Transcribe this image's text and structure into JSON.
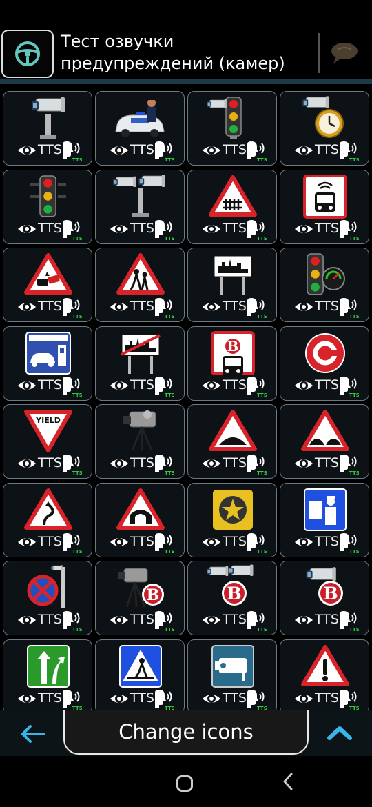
{
  "header": {
    "title": "Тест озвучки предупреждений (камер)"
  },
  "tile_common": {
    "tts_label": "TTS"
  },
  "tiles": [
    {
      "icon": "speed-camera-pole-icon"
    },
    {
      "icon": "police-car-officer-icon"
    },
    {
      "icon": "traffic-light-camera-icon"
    },
    {
      "icon": "camera-clock-icon"
    },
    {
      "icon": "traffic-light-icon"
    },
    {
      "icon": "double-camera-pole-icon"
    },
    {
      "icon": "railroad-crossing-sign-icon"
    },
    {
      "icon": "bus-lane-camera-sign-icon"
    },
    {
      "icon": "car-crash-sign-icon"
    },
    {
      "icon": "school-children-sign-icon"
    },
    {
      "icon": "town-entry-sign-icon"
    },
    {
      "icon": "traffic-light-speedometer-icon"
    },
    {
      "icon": "toll-car-sign-icon"
    },
    {
      "icon": "town-exit-sign-icon"
    },
    {
      "icon": "bus-lane-b-sign-icon"
    },
    {
      "icon": "congestion-charge-c-icon"
    },
    {
      "icon": "yield-sign-icon"
    },
    {
      "icon": "mobile-camera-tripod-icon"
    },
    {
      "icon": "speed-bump-sign-icon"
    },
    {
      "icon": "road-bumps-sign-icon"
    },
    {
      "icon": "winding-road-sign-icon"
    },
    {
      "icon": "tunnel-sign-icon"
    },
    {
      "icon": "star-sign-icon"
    },
    {
      "icon": "police-control-sign-icon"
    },
    {
      "icon": "no-stopping-camera-icon"
    },
    {
      "icon": "tripod-camera-b-icon"
    },
    {
      "icon": "double-camera-b-icon"
    },
    {
      "icon": "camera-b-icon"
    },
    {
      "icon": "highway-exit-sign-icon"
    },
    {
      "icon": "pedestrian-crossing-sign-icon"
    },
    {
      "icon": "camera-blue-sign-icon"
    },
    {
      "icon": "warning-exclamation-sign-icon"
    }
  ],
  "footer": {
    "change_label": "Change icons"
  },
  "colors": {
    "accent": "#38b6e8",
    "tts_badge": "#2ecc40"
  }
}
